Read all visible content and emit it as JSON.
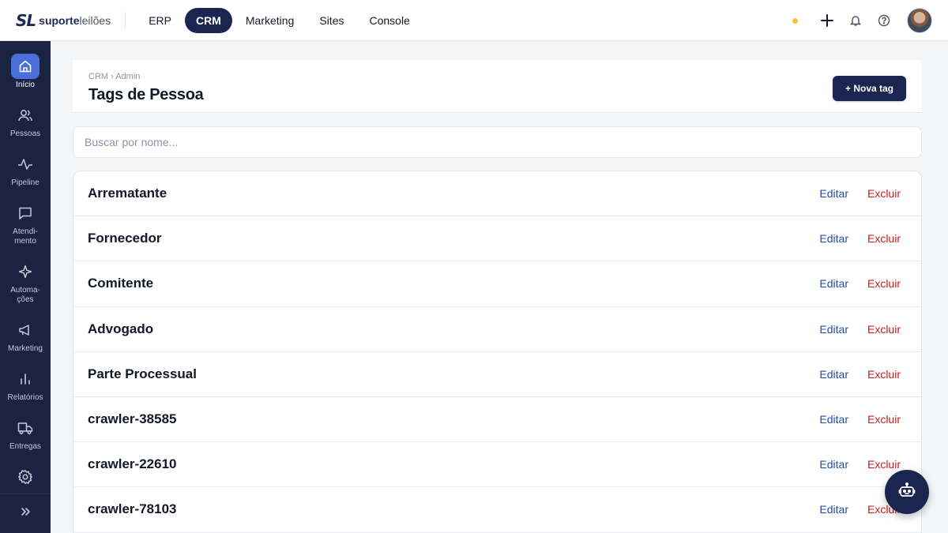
{
  "brand": {
    "mark": "SL",
    "name_bold": "suporte",
    "name_light": "leilões"
  },
  "topnav": [
    {
      "label": "ERP",
      "active": false
    },
    {
      "label": "CRM",
      "active": true
    },
    {
      "label": "Marketing",
      "active": false
    },
    {
      "label": "Sites",
      "active": false
    },
    {
      "label": "Console",
      "active": false
    }
  ],
  "topbar_icons": [
    "status-dot",
    "plus-icon",
    "bell-icon",
    "help-icon",
    "avatar"
  ],
  "sidebar": {
    "items": [
      {
        "label": "Início",
        "icon": "home-icon",
        "active": true
      },
      {
        "label": "Pessoas",
        "icon": "people-icon"
      },
      {
        "label": "Pipeline",
        "icon": "pulse-icon"
      },
      {
        "label": "Atendi-\nmento",
        "icon": "chat-icon"
      },
      {
        "label": "Automa-\nções",
        "icon": "sparkle-icon"
      },
      {
        "label": "Marketing",
        "icon": "megaphone-icon"
      },
      {
        "label": "Relatórios",
        "icon": "bar-chart-icon"
      },
      {
        "label": "Entregas",
        "icon": "truck-icon"
      },
      {
        "label": "",
        "icon": "gear-icon"
      }
    ],
    "collapse_icon": "double-chevron-right-icon"
  },
  "header": {
    "breadcrumb": "CRM › Admin",
    "title": "Tags de Pessoa",
    "new_button": "+ Nova tag"
  },
  "search": {
    "placeholder": "Buscar por nome..."
  },
  "tags": [
    {
      "name": "Arrematante",
      "edit": "Editar",
      "delete": "Excluir"
    },
    {
      "name": "Fornecedor",
      "edit": "Editar",
      "delete": "Excluir"
    },
    {
      "name": "Comitente",
      "edit": "Editar",
      "delete": "Excluir"
    },
    {
      "name": "Advogado",
      "edit": "Editar",
      "delete": "Excluir"
    },
    {
      "name": "Parte Processual",
      "edit": "Editar",
      "delete": "Excluir"
    },
    {
      "name": "crawler-38585",
      "edit": "Editar",
      "delete": "Excluir"
    },
    {
      "name": "crawler-22610",
      "edit": "Editar",
      "delete": "Excluir"
    },
    {
      "name": "crawler-78103",
      "edit": "Editar",
      "delete": "Excluir"
    }
  ],
  "colors": {
    "primary": "#1a2550",
    "sidebar": "#1a2341",
    "active_icon": "#4b6fd8",
    "edit": "#1f4fa3",
    "delete": "#c81e1e",
    "status": "#f5c242"
  },
  "fab_icon": "robot-icon"
}
